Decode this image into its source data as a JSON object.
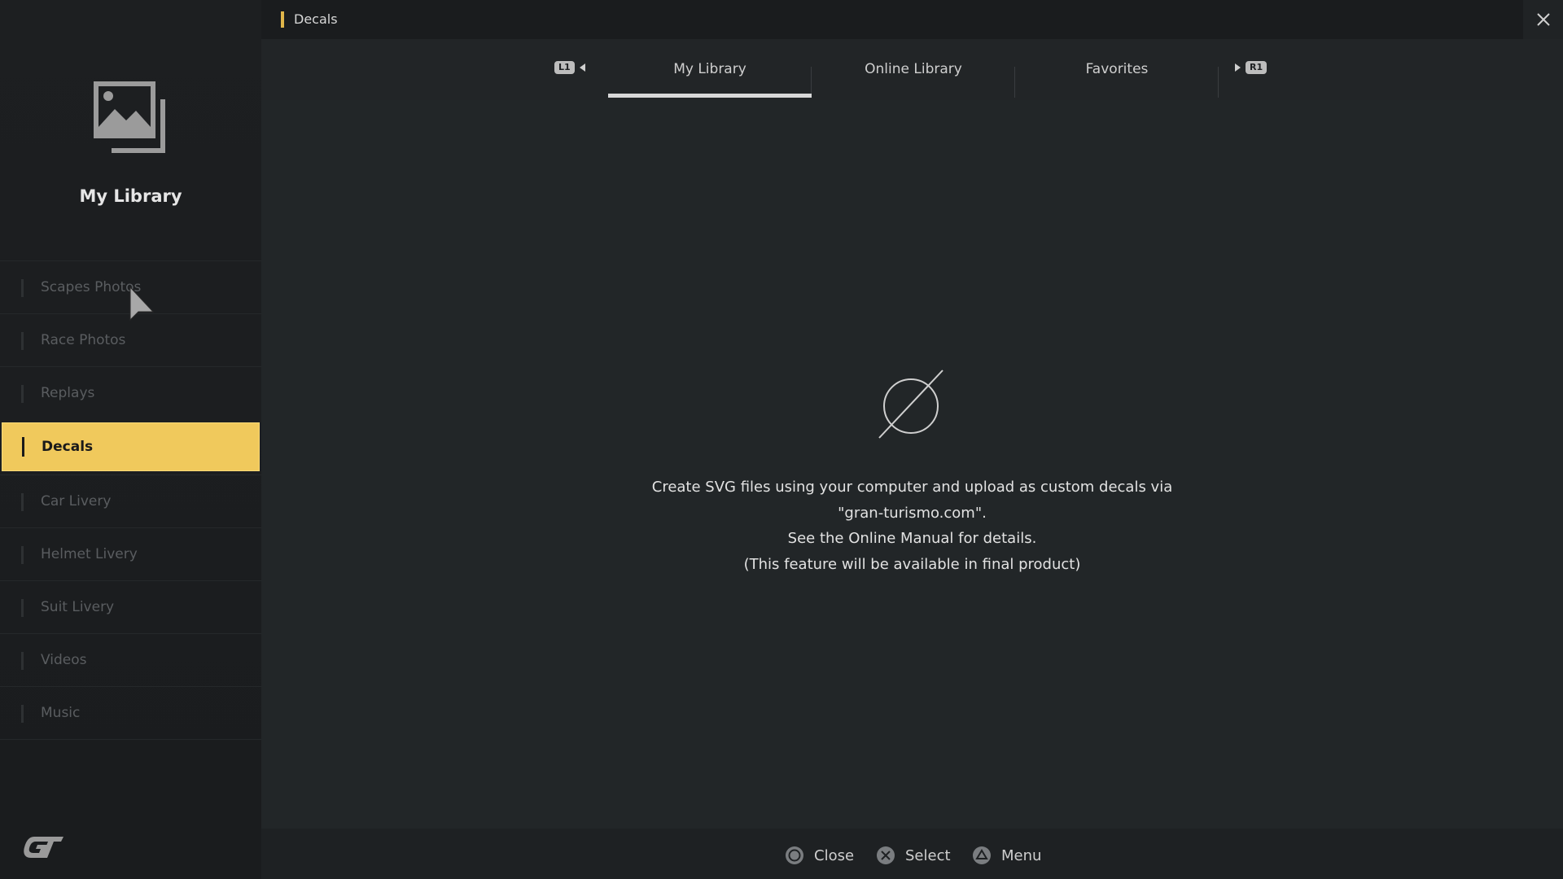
{
  "sidebar": {
    "title": "My Library",
    "icon": "image-library-icon",
    "items": [
      {
        "label": "Scapes Photos",
        "active": false
      },
      {
        "label": "Race Photos",
        "active": false
      },
      {
        "label": "Replays",
        "active": false
      },
      {
        "label": "Decals",
        "active": true
      },
      {
        "label": "Car Livery",
        "active": false
      },
      {
        "label": "Helmet Livery",
        "active": false
      },
      {
        "label": "Suit Livery",
        "active": false
      },
      {
        "label": "Videos",
        "active": false
      },
      {
        "label": "Music",
        "active": false
      }
    ],
    "logo": "gt-logo"
  },
  "header": {
    "breadcrumb": "Decals",
    "close_icon": "close-icon"
  },
  "tabs": {
    "left_button": "L1",
    "right_button": "R1",
    "items": [
      {
        "label": "My Library",
        "active": true
      },
      {
        "label": "Online Library",
        "active": false
      },
      {
        "label": "Favorites",
        "active": false
      }
    ]
  },
  "main": {
    "empty_icon": "empty-set-icon",
    "message_lines": [
      "Create SVG files using your computer and upload as custom decals via",
      "\"gran-turismo.com\".",
      "See the Online Manual for details.",
      "(This feature will be available in final product)"
    ]
  },
  "footer": {
    "hints": [
      {
        "icon": "circle-button-icon",
        "label": "Close"
      },
      {
        "icon": "cross-button-icon",
        "label": "Select"
      },
      {
        "icon": "triangle-button-icon",
        "label": "Menu"
      }
    ]
  },
  "colors": {
    "accent": "#f0c95c",
    "background": "#222628",
    "sidebar": "#1d1f21"
  }
}
